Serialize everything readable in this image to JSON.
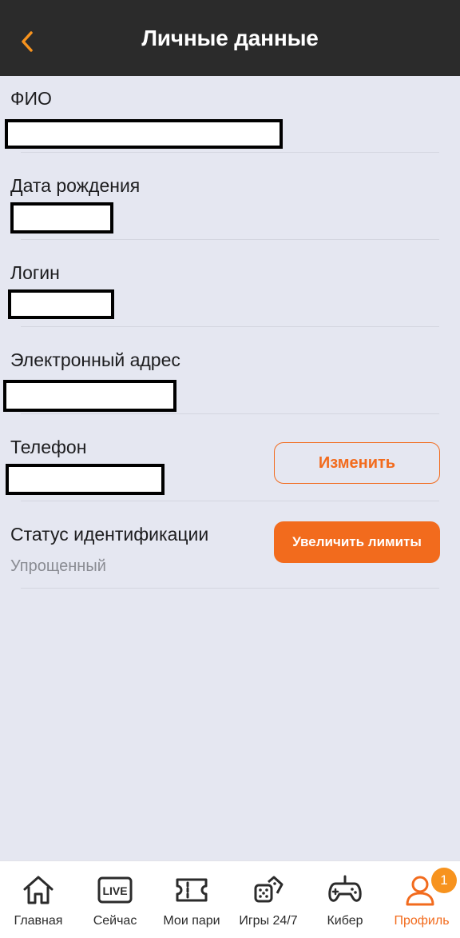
{
  "header": {
    "title": "Личные данные",
    "back_icon": "chevron-left-icon"
  },
  "fields": {
    "fio": {
      "label": "ФИО"
    },
    "birth_date": {
      "label": "Дата рождения"
    },
    "login": {
      "label": "Логин"
    },
    "email": {
      "label": "Электронный адрес"
    },
    "phone": {
      "label": "Телефон",
      "change_button": "Изменить"
    },
    "identification": {
      "label": "Статус идентификации",
      "value": "Упрощенный",
      "button": "Увеличить лимиты"
    }
  },
  "bottom_nav": {
    "items": [
      {
        "label": "Главная",
        "icon": "home-icon"
      },
      {
        "label": "Сейчас",
        "icon": "live-icon",
        "icon_text": "LIVE"
      },
      {
        "label": "Мои пари",
        "icon": "ticket-icon"
      },
      {
        "label": "Игры 24/7",
        "icon": "dice-icon"
      },
      {
        "label": "Кибер",
        "icon": "gamepad-icon"
      },
      {
        "label": "Профиль",
        "icon": "user-icon",
        "badge": "1",
        "active": true
      }
    ]
  },
  "colors": {
    "accent": "#f26b1d",
    "header_bg": "#2b2b2b",
    "page_bg": "#e5e7f1",
    "badge": "#f7931e"
  }
}
